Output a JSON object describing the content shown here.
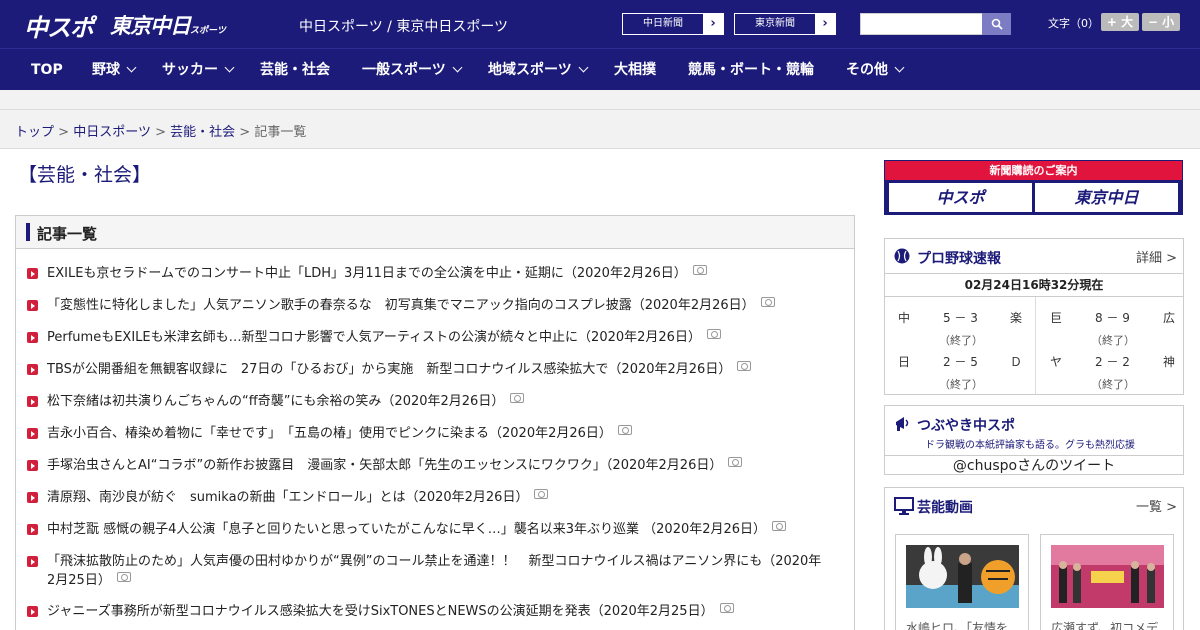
{
  "header": {
    "logo_main": "中スポ",
    "logo_tokyo": "東京中日",
    "logo_tokyo_small": "スポーツ",
    "site_names": "中日スポーツ / 東京中日スポーツ",
    "link_chunichi": "中日新聞",
    "link_tokyo": "東京新聞",
    "search_placeholder": "",
    "font_size_label": "文字（0）",
    "font_bigger": "+ 大",
    "font_smaller": "− 小"
  },
  "nav": {
    "items": [
      {
        "label": "TOP",
        "has_menu": false
      },
      {
        "label": "野球",
        "has_menu": true
      },
      {
        "label": "サッカー",
        "has_menu": true
      },
      {
        "label": "芸能・社会",
        "has_menu": false
      },
      {
        "label": "一般スポーツ",
        "has_menu": true
      },
      {
        "label": "地域スポーツ",
        "has_menu": true
      },
      {
        "label": "大相撲",
        "has_menu": false
      },
      {
        "label": "競馬・ボート・競輪",
        "has_menu": false
      },
      {
        "label": "その他",
        "has_menu": true
      }
    ]
  },
  "breadcrumb": {
    "items": [
      "トップ",
      "中日スポーツ",
      "芸能・社会"
    ],
    "current": "記事一覧",
    "separator": ">"
  },
  "category_title": "【芸能・社会】",
  "article_list": {
    "heading": "記事一覧",
    "articles": [
      {
        "title": "EXILEも京セラドームでのコンサート中止「LDH」3月11日までの全公演を中止・延期に（2020年2月26日）"
      },
      {
        "title": "「変態性に特化しました」人気アニソン歌手の春奈るな　初写真集でマニアック指向のコスプレ披露（2020年2月26日）"
      },
      {
        "title": "PerfumeもEXILEも米津玄師も…新型コロナ影響で人気アーティストの公演が続々と中止に（2020年2月26日）"
      },
      {
        "title": "TBSが公開番組を無観客収録に　27日の「ひるおび」から実施　新型コロナウイルス感染拡大で（2020年2月26日）"
      },
      {
        "title": "松下奈緒は初共演りんごちゃんの“ff奇襲”にも余裕の笑み（2020年2月26日）"
      },
      {
        "title": "吉永小百合、椿染め着物に「幸せです」　「五島の椿」使用でピンクに染まる（2020年2月26日）"
      },
      {
        "title": "手塚治虫さんとAI“コラボ”の新作お披露目　漫画家・矢部太郎「先生のエッセンスにワクワク」（2020年2月26日）"
      },
      {
        "title": "清原翔、南沙良が紡ぐ　sumikaの新曲「エンドロール」とは（2020年2月26日）"
      },
      {
        "title": "中村芝翫 感慨の親子4人公演「息子と回りたいと思っていたがこんなに早く…」襲名以来3年ぶり巡業 （2020年2月26日）"
      },
      {
        "title": "「飛沫拡散防止のため」人気声優の田村ゆかりが“異例”のコール禁止を通達！！　新型コロナウイルス禍はアニソン界にも（2020年2月25日）"
      },
      {
        "title": "ジャニーズ事務所が新型コロナウイルス感染拡大を受けSixTONESとNEWSの公演延期を発表（2020年2月25日）"
      }
    ]
  },
  "sidebar": {
    "subscription": {
      "title": "新聞購読のご案内",
      "logo_left": "中スポ",
      "logo_right": "東京中日"
    },
    "baseball": {
      "title": "プロ野球速報",
      "more": "詳細 >",
      "time": "02月24日16時32分現在",
      "games": [
        {
          "home": "中",
          "score": "5 － 3",
          "away": "楽",
          "status": "（終了）"
        },
        {
          "home": "巨",
          "score": "8 － 9",
          "away": "広",
          "status": "（終了）"
        },
        {
          "home": "日",
          "score": "2 － 5",
          "away": "Ｄ",
          "status": "（終了）"
        },
        {
          "home": "ヤ",
          "score": "2 － 2",
          "away": "神",
          "status": "（終了）"
        }
      ]
    },
    "tweets": {
      "title": "つぶやき中スポ",
      "subtitle": "ドラ観戦の本紙評論家も語る。グラも熱烈応援",
      "line": "@chuspoさんのツイート"
    },
    "video": {
      "title": "芸能動画",
      "more": "一覧 >",
      "cards": [
        {
          "caption": "水嶋ヒロ、「友情を"
        },
        {
          "caption": "広瀬すず、初コメデ"
        }
      ]
    }
  },
  "colors": {
    "brand_navy": "#1c1b79",
    "bullet_red": "#d21f3c",
    "banner_red": "#e0143c"
  }
}
